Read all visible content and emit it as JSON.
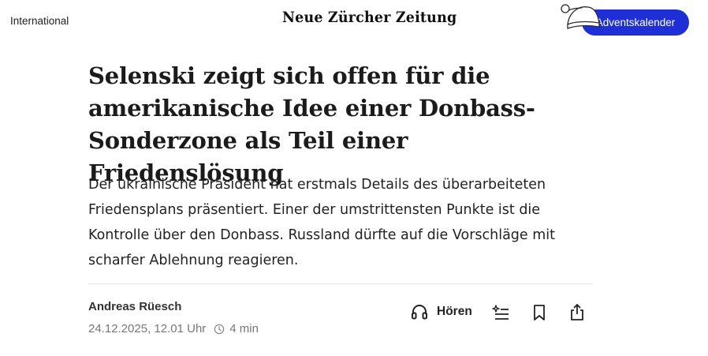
{
  "header": {
    "section": "International",
    "logo": "Neue Zürcher Zeitung",
    "cta_label": "Adventskalender"
  },
  "article": {
    "title": "Selenski zeigt sich offen für die amerikanische Idee einer Donbass-Sonderzone als Teil einer Friedenslösung",
    "lead": "Der ukrainische Präsident hat erstmals Details des überarbeiteten Friedensplans präsentiert. Einer der umstrittensten Punkte ist die Kontrolle über den Donbass. Russland dürfte auf die Vorschläge mit scharfer Ablehnung reagieren.",
    "author": "Andreas Rüesch",
    "date": "24.12.2025, 12.01 Uhr",
    "reading_time": "4 min"
  },
  "tools": {
    "listen_label": "Hören",
    "icons": [
      "headphones-icon",
      "summary-sparkle-icon",
      "bookmark-icon",
      "share-icon"
    ]
  },
  "colors": {
    "accent": "#1e2fd6",
    "text": "#1b1b1b",
    "muted": "#777777",
    "divider": "#e3e3e3"
  }
}
